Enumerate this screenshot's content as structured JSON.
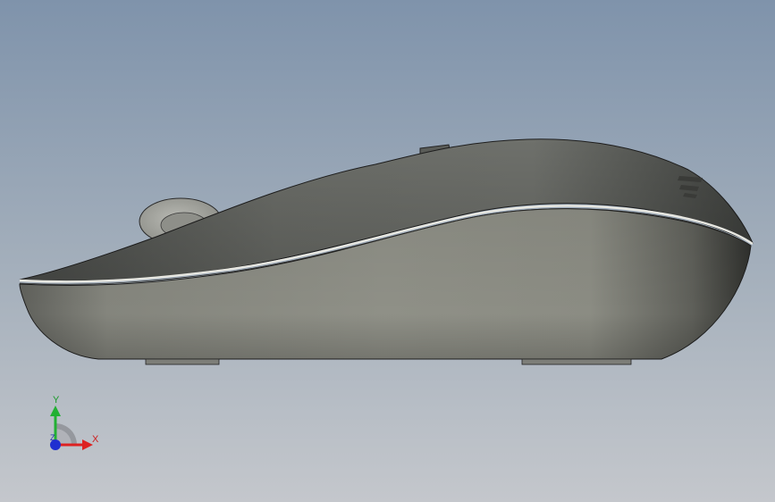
{
  "viewport": {
    "background_top": "#7f93ab",
    "background_bottom": "#c4c7cc"
  },
  "model": {
    "name": "wireless-mouse-side-view",
    "body_color": "#8a8b83",
    "top_shell_color": "#5e605c"
  },
  "triad": {
    "y_label": "Y",
    "x_label": "X",
    "z_label": "Z",
    "y_color": "#22b033",
    "x_color": "#dd2222",
    "z_color": "#1f2fd0"
  }
}
